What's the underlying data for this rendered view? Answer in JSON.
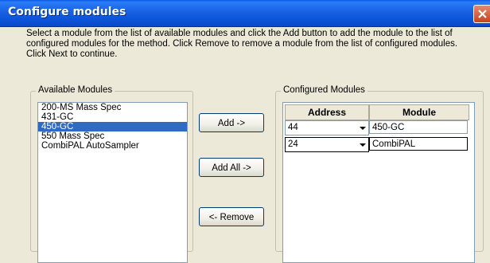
{
  "window": {
    "title": "Configure modules"
  },
  "instructions": "Select a module from the list of available modules and click the Add button to add the module to the list of configured modules for the method. Click Remove to remove a module from the list of configured modules. Click Next to continue.",
  "available": {
    "label": "Available Modules",
    "items": [
      {
        "label": "200-MS Mass Spec",
        "selected": false
      },
      {
        "label": "431-GC",
        "selected": false
      },
      {
        "label": "450-GC",
        "selected": true
      },
      {
        "label": "550 Mass Spec",
        "selected": false
      },
      {
        "label": "CombiPAL AutoSampler",
        "selected": false
      }
    ]
  },
  "buttons": {
    "add": "Add ->",
    "add_all": "Add All ->",
    "remove": "<- Remove"
  },
  "configured": {
    "label": "Configured Modules",
    "columns": [
      "Address",
      "Module"
    ],
    "rows": [
      {
        "address": "44",
        "module": "450-GC"
      },
      {
        "address": "24",
        "module": "CombiPAL"
      }
    ]
  },
  "colors": {
    "selection": "#316ac5",
    "titlebar": "#0b53d8",
    "close": "#c7421f"
  }
}
